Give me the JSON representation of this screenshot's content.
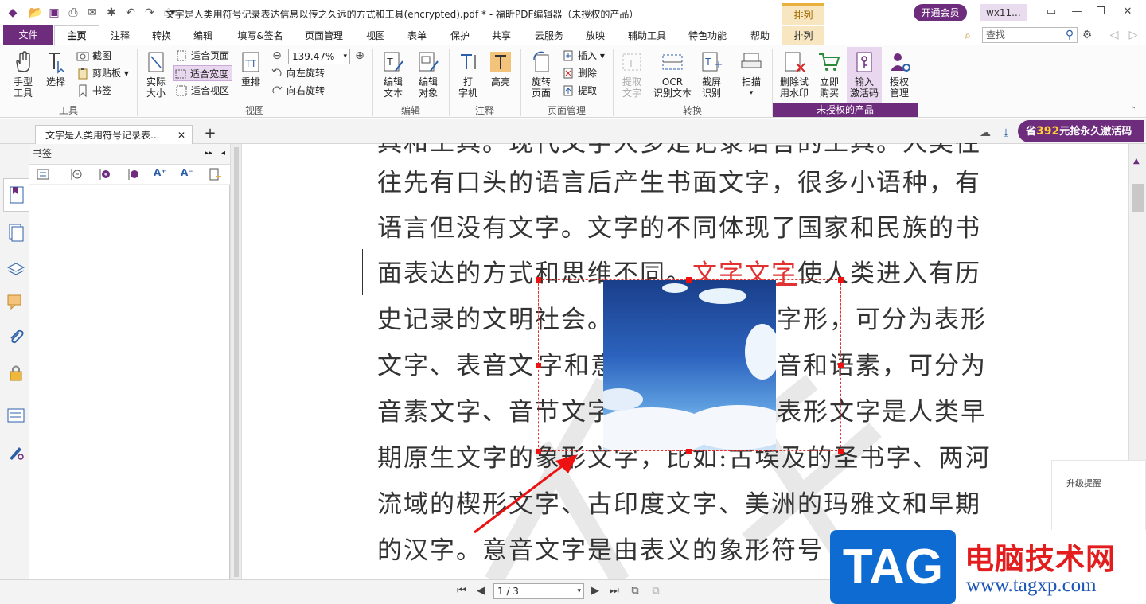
{
  "window": {
    "title": "文字是人类用符号记录表达信息以传之久远的方式和工具(encrypted).pdf * - 福昕PDF编辑器（未授权的产品）",
    "context_tab": "排列",
    "vip_button": "开通会员",
    "user": "wx11..."
  },
  "menu": {
    "file": "文件",
    "items": [
      "主页",
      "注释",
      "转换",
      "编辑",
      "填写&签名",
      "页面管理",
      "视图",
      "表单",
      "保护",
      "共享",
      "云服务",
      "放映",
      "辅助工具",
      "特色功能",
      "帮助",
      "排列"
    ],
    "search_placeholder": "查找"
  },
  "ribbon": {
    "groups": {
      "tools": "工具",
      "view": "视图",
      "edit": "编辑",
      "comment": "注释",
      "page_manage": "页面管理",
      "convert": "转换",
      "unauthorized": "未授权的产品"
    },
    "hand": "手型\n工具",
    "select": "选择",
    "screenshot": "截图",
    "clipboard": "剪贴板",
    "bookmark": "书签",
    "actual_size": "实际\n大小",
    "fit_page": "适合页面",
    "fit_width": "适合宽度",
    "fit_view": "适合视区",
    "reflow": "重排",
    "zoom": "139.47%",
    "rotate_left": "向左旋转",
    "rotate_right": "向右旋转",
    "edit_text": "编辑\n文本",
    "edit_object": "编辑\n对象",
    "typewriter": "打\n字机",
    "highlight": "高亮",
    "rotate_page": "旋转\n页面",
    "insert": "插入",
    "delete": "删除",
    "extract": "提取",
    "extract_text": "提取\n文字",
    "ocr": "OCR\n识别文本",
    "screen_ocr": "截屏\n识别",
    "scan": "扫描",
    "remove_watermark": "删除试\n用水印",
    "buy_now": "立即\n购买",
    "enter_code": "输入\n激活码",
    "license": "授权\n管理"
  },
  "tabs": {
    "doc_tab": "文字是人类用符号记录表...",
    "promo_prefix": "省",
    "promo_amount": "392",
    "promo_suffix": "元抢永久激活码"
  },
  "bookmark_panel": {
    "title": "书签"
  },
  "document": {
    "lines": [
      "具和工具。现代文字大多是记录语言的工具。人类往",
      "往先有口头的语言后产生书面文字，很多小语种，有",
      "语言但没有文字。文字的不同体现了国家和民族的书",
      "面表达的方式和思维不同。",
      "史记录的文明社会。",
      "文字、表音文",
      "音素文字、音节文字",
      "期原生文字的象形文字，比如:古埃及的圣书字、两河",
      "流域的楔形文字、古印度文字、美洲的玛雅文和早期",
      "的汉字。意音文字是由表义的象形符号"
    ],
    "highlighted": "文字文字",
    "line4_tail": "使人类进入有历",
    "line5_tail": "字形，可分为表形",
    "line6_mid": "字和意",
    "line6_tail": "音和语素，可分为",
    "line7_tail": "表形文字是人类早"
  },
  "upgrade_notice": "升级提醒",
  "status": {
    "page": "1 / 3"
  },
  "logo": {
    "tag": "TAG",
    "name": "电脑技术网",
    "url": "www.tagxp.com"
  },
  "colors": {
    "brand_purple": "#6e2c7d",
    "selection_red": "#e23131",
    "promo_gold": "#ffcf33"
  }
}
